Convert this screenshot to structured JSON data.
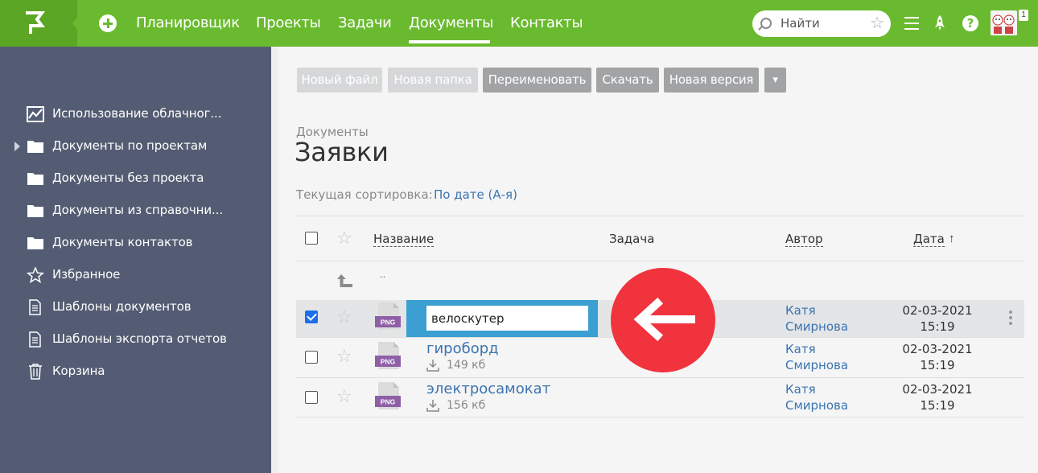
{
  "nav": {
    "items": [
      "Планировщик",
      "Проекты",
      "Задачи",
      "Документы",
      "Контакты"
    ],
    "active": "Документы",
    "search_placeholder": "Найти",
    "notification_count": "1"
  },
  "sidebar": {
    "items": [
      {
        "label": "Использование облачног...",
        "icon": "chart-icon"
      },
      {
        "label": "Документы по проектам",
        "icon": "folder-icon"
      },
      {
        "label": "Документы без проекта",
        "icon": "folder-icon"
      },
      {
        "label": "Документы из справочни...",
        "icon": "folder-icon"
      },
      {
        "label": "Документы контактов",
        "icon": "folder-icon"
      },
      {
        "label": "Избранное",
        "icon": "star-icon"
      },
      {
        "label": "Шаблоны документов",
        "icon": "document-icon"
      },
      {
        "label": "Шаблоны экспорта отчетов",
        "icon": "document-icon"
      },
      {
        "label": "Корзина",
        "icon": "trash-icon"
      }
    ]
  },
  "toolbar": {
    "new_file": "Новый файл",
    "new_folder": "Новая папка",
    "rename": "Переименовать",
    "download": "Скачать",
    "new_version": "Новая версия",
    "more": "▾"
  },
  "page": {
    "breadcrumb": "Документы",
    "title": "Заявки",
    "sort_label": "Текущая сортировка:",
    "sort_value": "По дате (А-я)"
  },
  "table": {
    "headers": {
      "name": "Название",
      "task": "Задача",
      "author": "Автор",
      "date": "Дата",
      "sort_arrow": "↑"
    },
    "parent_link": "..",
    "rows": [
      {
        "name": "велоскутер",
        "type": "PNG",
        "size": "",
        "author_first": "Катя",
        "author_last": "Смирнова",
        "date": "02-03-2021",
        "time": "15:19",
        "checked": true,
        "editing": true
      },
      {
        "name": "гироборд",
        "type": "PNG",
        "size": "149 кб",
        "author_first": "Катя",
        "author_last": "Смирнова",
        "date": "02-03-2021",
        "time": "15:19",
        "checked": false,
        "editing": false
      },
      {
        "name": "электросамокат",
        "type": "PNG",
        "size": "156 кб",
        "author_first": "Катя",
        "author_last": "Смирнова",
        "date": "02-03-2021",
        "time": "15:19",
        "checked": false,
        "editing": false
      }
    ]
  },
  "colors": {
    "brand_green": "#6aba2f",
    "sidebar_bg": "#535c72",
    "link_blue": "#3b74b0",
    "rename_highlight": "#3b9fd1",
    "annotation_red": "#f0333d"
  }
}
